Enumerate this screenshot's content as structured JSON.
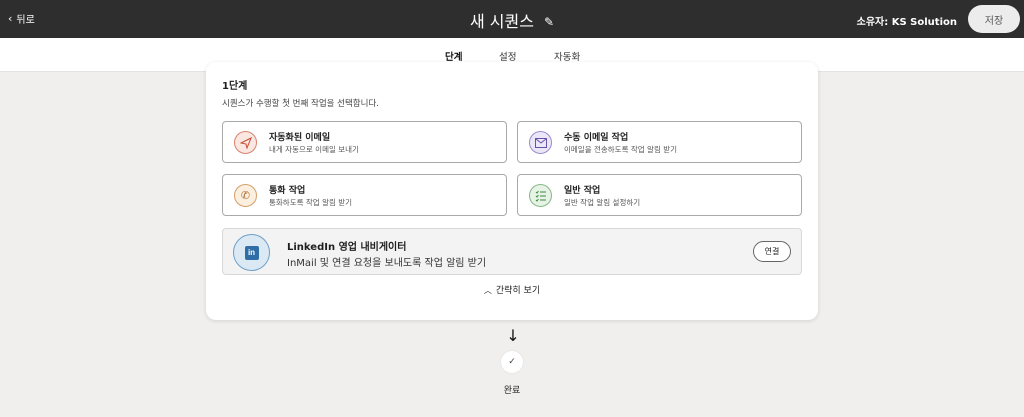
{
  "header": {
    "back_label": "뒤로",
    "title": "새 시퀀스",
    "owner_label": "소유자: KS Solution",
    "save_label": "저장"
  },
  "tabs": [
    {
      "label": "단계",
      "active": true
    },
    {
      "label": "설정",
      "active": false
    },
    {
      "label": "자동화",
      "active": false
    }
  ],
  "step": {
    "title": "1단계",
    "description": "시퀀스가 수행할 첫 번째 작업을 선택합니다.",
    "options": [
      {
        "title": "자동화된 이메일",
        "subtitle": "내게 자동으로 이메일 보내기",
        "icon": "send-icon"
      },
      {
        "title": "수동 이메일 작업",
        "subtitle": "이메일을 전송하도록 작업 알림 받기",
        "icon": "mail-icon"
      },
      {
        "title": "통화 작업",
        "subtitle": "통화하도록 작업 알림 받기",
        "icon": "phone-icon"
      },
      {
        "title": "일반 작업",
        "subtitle": "일반 작업 알림 설정하기",
        "icon": "checklist-icon"
      }
    ],
    "linkedin": {
      "title": "LinkedIn 영업 내비게이터",
      "subtitle": "InMail 및 연결 요청을 보내도록 작업 알림 받기",
      "icon_text": "in",
      "connect_label": "연결"
    },
    "collapse_label": "간략히 보기"
  },
  "end": {
    "label": "완료"
  },
  "colors": {
    "topbar": "#2e2e2e",
    "background": "#f0efee"
  }
}
